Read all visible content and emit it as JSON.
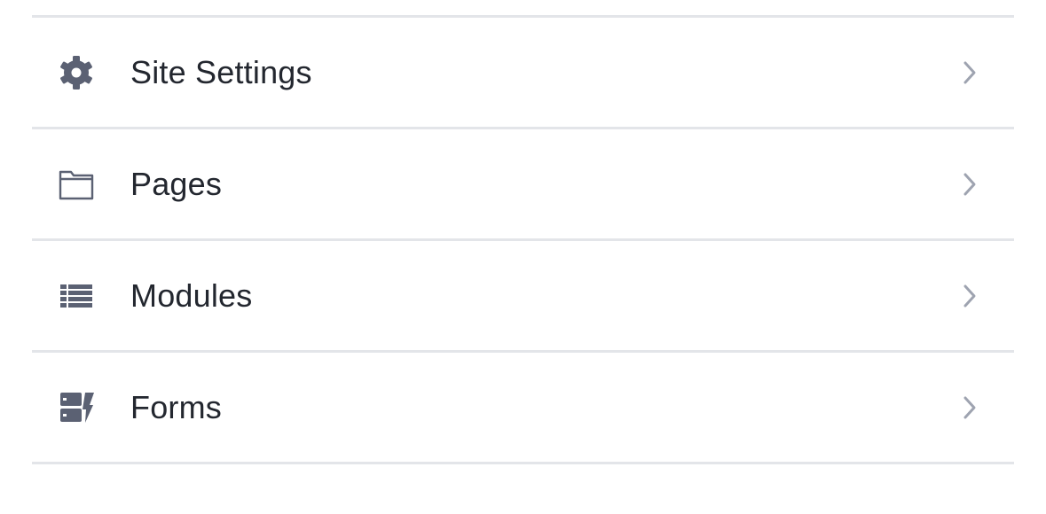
{
  "colors": {
    "icon": "#5b6173",
    "label": "#23272f",
    "divider": "#e3e5e9",
    "chevron": "#9ea3b0"
  },
  "menu": {
    "items": [
      {
        "id": "site-settings",
        "label": "Site Settings",
        "icon": "gear-icon"
      },
      {
        "id": "pages",
        "label": "Pages",
        "icon": "folder-icon"
      },
      {
        "id": "modules",
        "label": "Modules",
        "icon": "list-icon"
      },
      {
        "id": "forms",
        "label": "Forms",
        "icon": "form-bolt-icon"
      }
    ]
  }
}
